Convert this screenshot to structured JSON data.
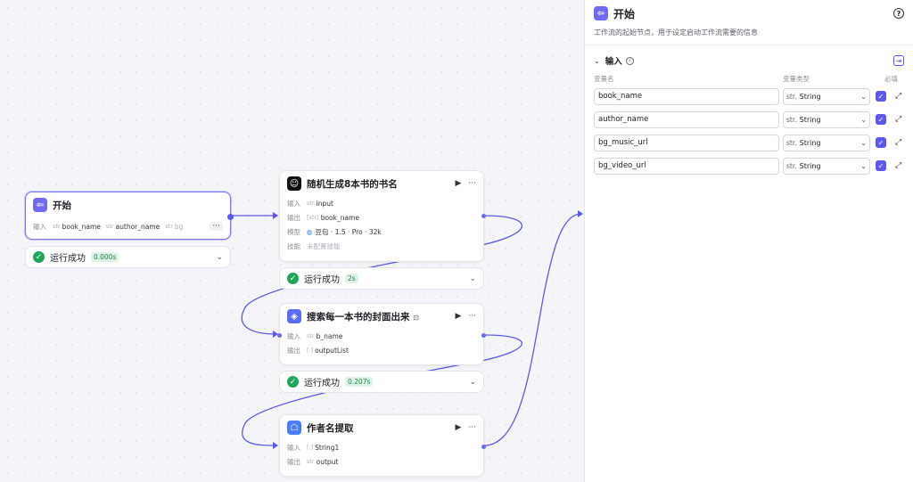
{
  "nodes": {
    "start": {
      "title": "开始",
      "input_label": "输入",
      "params": [
        "book_name",
        "author_name",
        "bg"
      ],
      "more": "···",
      "status": "运行成功",
      "time": "0.000s"
    },
    "llm": {
      "title": "随机生成8本书的书名",
      "run": "▶",
      "more": "···",
      "input_label": "输入",
      "input": "input",
      "output_label": "输出",
      "output": "book_name",
      "model_label": "模型",
      "model": "豆包 · 1.5 · Pro · 32k",
      "skill_label": "技能",
      "skill": "未配置技能",
      "status": "运行成功",
      "time": "2s"
    },
    "plugin": {
      "title": "搜索每一本书的封面出来",
      "run": "▶",
      "more": "···",
      "input_label": "输入",
      "input": "b_name",
      "output_label": "输出",
      "output": "outputList",
      "status": "运行成功",
      "time": "0.207s"
    },
    "code": {
      "title": "作者名提取",
      "run": "▶",
      "more": "···",
      "input_label": "输入",
      "input": "String1",
      "output_label": "输出",
      "output": "output"
    }
  },
  "panel": {
    "title": "开始",
    "description": "工作流的起始节点，用于设定启动工作流需要的信息",
    "section_title": "输入",
    "col_name": "变量名",
    "col_type": "变量类型",
    "col_required": "必填",
    "variables": [
      {
        "name": "book_name",
        "type_prefix": "str.",
        "type": "String"
      },
      {
        "name": "author_name",
        "type_prefix": "str.",
        "type": "String"
      },
      {
        "name": "bg_music_url",
        "type_prefix": "str.",
        "type": "String"
      },
      {
        "name": "bg_video_url",
        "type_prefix": "str.",
        "type": "String"
      }
    ]
  },
  "colors": {
    "accent": "#5c58e8",
    "success": "#1fa659",
    "edge": "#5c58e8"
  },
  "icons": {
    "start": "login-arrow-icon",
    "llm": "bot-icon",
    "plugin": "cube-icon",
    "code": "robot-icon"
  }
}
